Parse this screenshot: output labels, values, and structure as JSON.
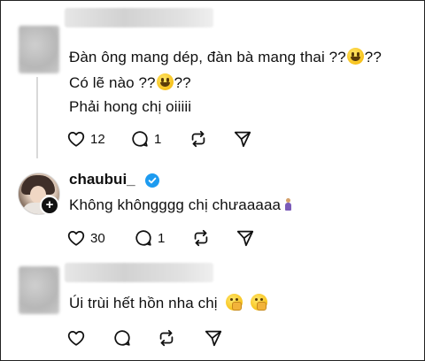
{
  "thread": [
    {
      "author": "",
      "lines": [
        {
          "text": "Đàn ông mang dép, đàn bà mang thai ??",
          "emoji": "grinning-face-emoji",
          "suffix": "??"
        },
        {
          "text": "Có lẽ nào ??",
          "emoji": "grinning-face-emoji",
          "suffix": "??"
        },
        {
          "text": "Phải hong chị oiiiii",
          "emoji": "",
          "suffix": ""
        }
      ],
      "stats": {
        "likes": "12",
        "replies": "1"
      }
    },
    {
      "author": "chaubui_",
      "verified": true,
      "lines": [
        {
          "text": "Không khôngggg chị chưaaaaa",
          "emoji": "person-emoji",
          "suffix": ""
        }
      ],
      "stats": {
        "likes": "30",
        "replies": "1"
      }
    },
    {
      "author": "",
      "lines": [
        {
          "text": "Úi trùi hết hồn nha chị",
          "emoji": "hand-over-mouth-emoji",
          "suffix": ""
        }
      ],
      "stats": {
        "likes": "",
        "replies": ""
      }
    }
  ],
  "colors": {
    "text": "#101010",
    "verified": "#1d9bf0",
    "divider": "#d9d9d9",
    "emoji": "#f7c21b"
  }
}
